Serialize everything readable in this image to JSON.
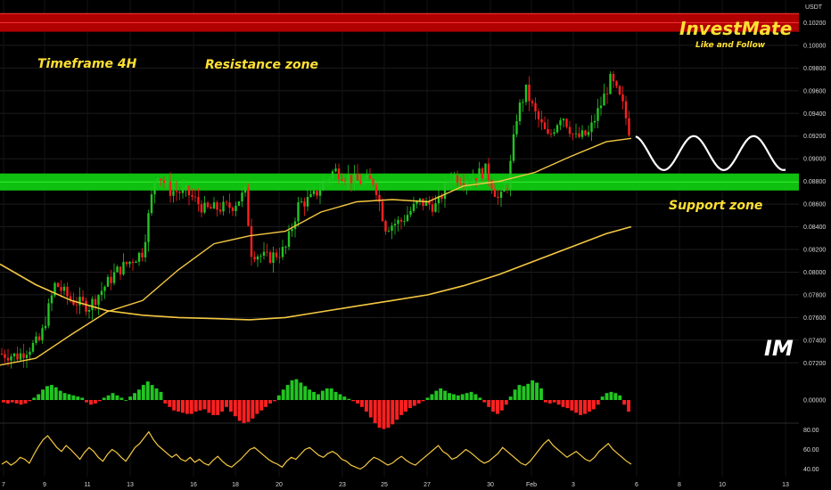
{
  "chart_data": {
    "type": "candlestick",
    "currency": "USDT",
    "price_ticks": [
      "0.10200",
      "0.10000",
      "0.09800",
      "0.09600",
      "0.09400",
      "0.09200",
      "0.09000",
      "0.08800",
      "0.08600",
      "0.08400",
      "0.08200",
      "0.08000",
      "0.07800",
      "0.07600",
      "0.07400",
      "0.07200"
    ],
    "price_range": [
      0.071,
      0.104
    ],
    "x_ticks": [
      "7",
      "9",
      "11",
      "13",
      "16",
      "18",
      "20",
      "23",
      "25",
      "27",
      "30",
      "Feb",
      "3",
      "6",
      "8",
      "10",
      "13"
    ],
    "annotations": {
      "timeframe": "Timeframe 4H",
      "resistance": "Resistance zone",
      "support": "Support zone"
    },
    "zones": {
      "resistance": [
        0.1012,
        0.1028
      ],
      "support": [
        0.0872,
        0.0887
      ]
    },
    "brand": {
      "name": "InvestMate",
      "tagline": "Like and Follow",
      "logo": "IM"
    },
    "colors": {
      "up": "#22c522",
      "down": "#ff2020",
      "ma": "#f5c842",
      "resistance": "#b00000",
      "support": "#10c010",
      "text": "#ffe033"
    },
    "macd": {
      "zero_label": "0.00000",
      "values": [
        -0.2,
        -0.3,
        -0.2,
        -0.3,
        -0.4,
        -0.3,
        -0.1,
        0.2,
        0.5,
        0.9,
        1.2,
        1.3,
        1.1,
        0.8,
        0.6,
        0.5,
        0.4,
        0.3,
        0.2,
        -0.2,
        -0.4,
        -0.3,
        -0.1,
        0.2,
        0.4,
        0.6,
        0.4,
        0.2,
        0.0,
        0.3,
        0.6,
        0.9,
        1.3,
        1.6,
        1.3,
        1.0,
        0.7,
        -0.3,
        -0.6,
        -0.9,
        -1.0,
        -1.1,
        -1.2,
        -1.2,
        -1.0,
        -0.9,
        -0.8,
        -1.1,
        -1.3,
        -1.3,
        -1.0,
        -0.6,
        -1.0,
        -1.4,
        -1.8,
        -2.0,
        -1.9,
        -1.6,
        -1.2,
        -0.9,
        -0.6,
        -0.3,
        -0.1,
        0.4,
        0.9,
        1.3,
        1.7,
        1.8,
        1.5,
        1.2,
        0.9,
        0.7,
        0.5,
        0.8,
        1.0,
        1.0,
        0.7,
        0.5,
        0.3,
        0.1,
        -0.1,
        -0.3,
        -0.6,
        -1.0,
        -1.5,
        -2.0,
        -2.4,
        -2.5,
        -2.4,
        -2.1,
        -1.7,
        -1.3,
        -1.0,
        -0.7,
        -0.5,
        -0.3,
        -0.1,
        0.2,
        0.5,
        0.8,
        1.0,
        0.8,
        0.6,
        0.5,
        0.4,
        0.5,
        0.6,
        0.7,
        0.5,
        0.2,
        -0.2,
        -0.6,
        -1.0,
        -1.2,
        -0.9,
        -0.4,
        0.3,
        0.9,
        1.3,
        1.2,
        1.4,
        1.7,
        1.5,
        1.0,
        -0.2,
        -0.3,
        -0.2,
        -0.4,
        -0.6,
        -0.7,
        -0.9,
        -1.1,
        -1.3,
        -1.2,
        -1.0,
        -0.8,
        -0.4,
        0.3,
        0.6,
        0.7,
        0.6,
        0.4,
        -0.4,
        -1.0
      ]
    },
    "rsi": {
      "ticks": [
        "80.00",
        "60.00",
        "40.00"
      ],
      "range": [
        35,
        85
      ],
      "values": [
        45,
        48,
        44,
        47,
        52,
        50,
        46,
        55,
        63,
        70,
        74,
        68,
        62,
        58,
        64,
        60,
        55,
        50,
        57,
        62,
        58,
        52,
        48,
        55,
        60,
        57,
        52,
        48,
        55,
        62,
        66,
        72,
        78,
        70,
        64,
        60,
        56,
        52,
        55,
        50,
        48,
        52,
        47,
        50,
        46,
        44,
        49,
        53,
        48,
        44,
        42,
        46,
        50,
        55,
        60,
        62,
        58,
        54,
        50,
        47,
        45,
        42,
        48,
        52,
        50,
        55,
        60,
        62,
        58,
        54,
        52,
        56,
        58,
        55,
        50,
        48,
        44,
        42,
        40,
        43,
        48,
        52,
        50,
        47,
        44,
        46,
        50,
        53,
        49,
        46,
        44,
        48,
        52,
        56,
        60,
        64,
        58,
        55,
        50,
        52,
        56,
        60,
        57,
        53,
        49,
        46,
        48,
        52,
        56,
        62,
        58,
        54,
        50,
        46,
        44,
        48,
        54,
        60,
        66,
        70,
        64,
        60,
        56,
        52,
        55,
        58,
        54,
        50,
        48,
        52,
        58,
        62,
        66,
        60,
        56,
        52,
        48,
        45
      ]
    }
  }
}
